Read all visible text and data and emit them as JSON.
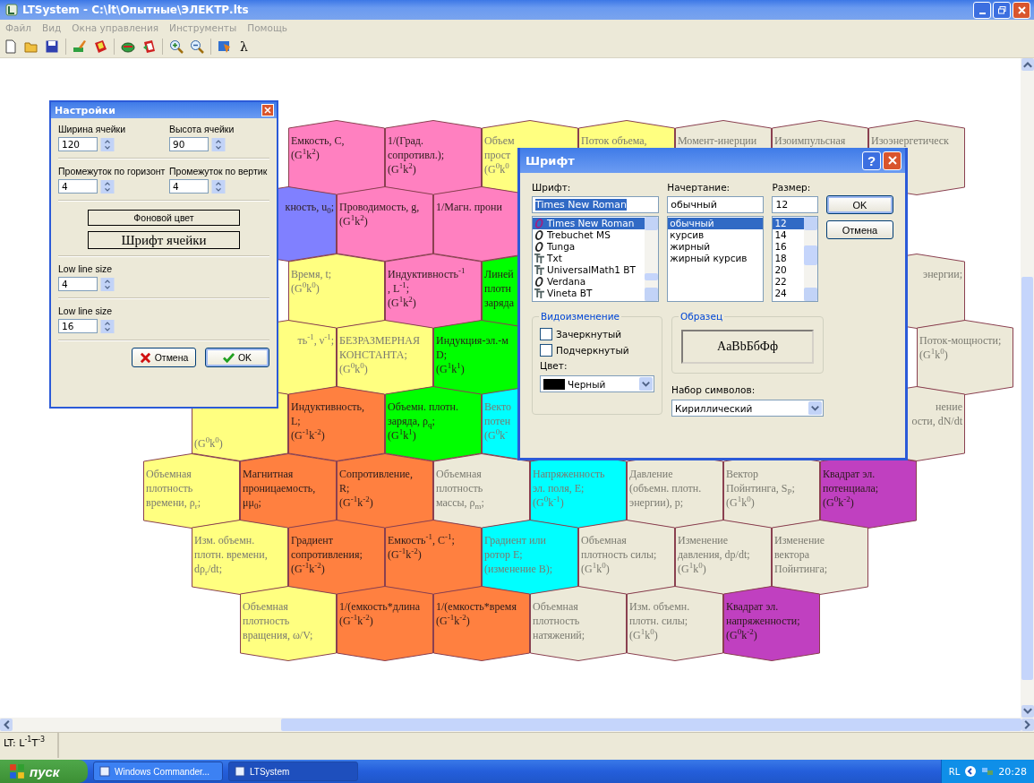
{
  "window": {
    "title": "LTSystem - C:\\lt\\Опытные\\ЭЛЕКТР.lts"
  },
  "menu": [
    "Файл",
    "Вид",
    "Окна управления",
    "Инструменты",
    "Помощь"
  ],
  "toolbar": {
    "lambda": "λ"
  },
  "grid": {
    "rows": [
      {
        "cells": [
          {
            "kind": "blank"
          },
          {
            "color": "#ff80c0",
            "kind": "full",
            "label": "Емкость, C,\n(G$^{1}$k$^{2}$)"
          },
          {
            "color": "#ff80c0",
            "kind": "full",
            "label": "1/(Град.\nсопротивл.);\n(G$^{1}$k$^{2}$)"
          },
          {
            "color": "#ffff80",
            "kind": "full",
            "label": "Объем\nпрост\n(G$^{0}$k$^{0}$"
          },
          {
            "color": "#ffff80",
            "kind": "full",
            "label": "Поток объема,"
          },
          {
            "color": "#ece9d8",
            "kind": "full",
            "label": "Момент-инерции"
          },
          {
            "color": "#ece9d8",
            "kind": "full",
            "label": "Изоимпульсная"
          },
          {
            "color": "#ece9d8",
            "kind": "full",
            "label": "Изоэнергетическ"
          }
        ]
      },
      {
        "cells": [
          {
            "kind": "blank"
          },
          {
            "color": "#8080ff",
            "kind": "cut-left",
            "label": "кность, u$_{0}$;"
          },
          {
            "color": "#ff80c0",
            "kind": "full",
            "label": "Проводимость, g,\n(G$^{1}$k$^{2}$)"
          },
          {
            "color": "#ff80c0",
            "kind": "full",
            "label": "1/Магн. прони"
          }
        ]
      },
      {
        "cells": [
          {
            "kind": "blank"
          },
          {
            "color": "#ffff80",
            "kind": "full",
            "label": "Время, t;\n(G$^{0}$k$^{0}$)"
          },
          {
            "color": "#ff80c0",
            "kind": "full",
            "label": "Индуктивность$^{-1}$\n, L$^{-1}$;\n(G$^{1}$k$^{2}$)"
          },
          {
            "color": "#00ff00",
            "kind": "full",
            "label": "Линей\nплотн\nзаряда"
          },
          {
            "kind": "blank"
          },
          {
            "kind": "blank"
          },
          {
            "kind": "blank"
          },
          {
            "color": "#ece9d8",
            "kind": "cut-left",
            "label": "энергии;"
          }
        ]
      },
      {
        "cells": [
          {
            "kind": "blank"
          },
          {
            "color": "#ffff80",
            "kind": "cut-left",
            "label": "ть$^{-1}$, ν$^{-1}$;"
          },
          {
            "color": "#ffff80",
            "kind": "full",
            "label": "БЕЗРАЗМЕРНАЯ\nКОНСТАНТА;\n(G$^{0}$k$^{0}$)"
          },
          {
            "color": "#00ff00",
            "kind": "full",
            "label": "Индукция-эл.-м\nD;\n(G$^{1}$k$^{1}$)"
          },
          {
            "kind": "blank"
          },
          {
            "kind": "blank"
          },
          {
            "kind": "blank"
          },
          {
            "kind": "blank"
          },
          {
            "color": "#ece9d8",
            "kind": "full",
            "label": "Поток-мощности;\n(G$^{1}$k$^{0}$)"
          }
        ]
      },
      {
        "cells": [
          {
            "color": "#ffff80",
            "kind": "cut-top",
            "label": "(G$^{0}$k$^{0}$)"
          },
          {
            "color": "#ff8040",
            "kind": "full",
            "label": "Индуктивность,\nL;\n(G$^{-1}$k$^{-2}$)"
          },
          {
            "color": "#00ff00",
            "kind": "full",
            "label": "Объемн. плотн.\nзаряда, ρ$_{q}$;\n(G$^{1}$k$^{1}$)"
          },
          {
            "color": "#00ffff",
            "kind": "full",
            "label": "Векто\nпотен\n(G$^{0}$k$^{-}$"
          },
          {
            "kind": "blank"
          },
          {
            "kind": "blank"
          },
          {
            "kind": "blank"
          },
          {
            "color": "#ece9d8",
            "kind": "cut-left",
            "label": "нение\nости, dN/dt"
          }
        ]
      },
      {
        "cells": [
          {
            "color": "#ffff80",
            "kind": "full",
            "label": "Объемная\nплотность\nвремени, ρ$_{r}$;"
          },
          {
            "color": "#ff8040",
            "kind": "full",
            "label": "Магнитная\nпроницаемость,\nμμ$_{0}$;"
          },
          {
            "color": "#ff8040",
            "kind": "full",
            "label": "Сопротивление,\nR;\n(G$^{-1}$k$^{-2}$)"
          },
          {
            "color": "#ece9d8",
            "kind": "full",
            "label": "Объемная\nплотность\nмассы, ρ$_{m}$;"
          },
          {
            "color": "#00ffff",
            "kind": "full",
            "label": "Напряженность\nэл. поля, E;\n(G$^{0}$k$^{-1}$)"
          },
          {
            "color": "#ece9d8",
            "kind": "full",
            "label": "Давление\n(объемн. плотн.\nэнергии), p;"
          },
          {
            "color": "#ece9d8",
            "kind": "full",
            "label": "Вектор\nПойнтинга, S$_{P}$;\n(G$^{1}$k$^{0}$)"
          },
          {
            "color": "#c040c0",
            "kind": "full",
            "label": "Квадрат эл.\nпотенциала;\n(G$^{0}$k$^{-2}$)"
          }
        ]
      },
      {
        "cells": [
          {
            "color": "#ffff80",
            "kind": "full",
            "label": "Изм. объемн.\nплотн. времени,\ndρ$_{r}$/dt;"
          },
          {
            "color": "#ff8040",
            "kind": "full",
            "label": "Градиент\nсопротивления;\n(G$^{-1}$k$^{-2}$)"
          },
          {
            "color": "#ff8040",
            "kind": "full",
            "label": "Емкость$^{-1}$, C$^{-1}$;\n(G$^{-1}$k$^{-2}$)"
          },
          {
            "color": "#00ffff",
            "kind": "full",
            "label": "Градиент или\nротор E;\n(изменение B);"
          },
          {
            "color": "#ece9d8",
            "kind": "full",
            "label": "Объемная\nплотность силы;\n(G$^{1}$k$^{0}$)"
          },
          {
            "color": "#ece9d8",
            "kind": "full",
            "label": "Изменение\nдавления, dp/dt;\n(G$^{1}$k$^{0}$)"
          },
          {
            "color": "#ece9d8",
            "kind": "full",
            "label": "Изменение\nвектора\nПойнтинга;"
          }
        ]
      },
      {
        "cells": [
          {
            "kind": "blank"
          },
          {
            "color": "#ffff80",
            "kind": "full",
            "label": "Объемная\nплотность\nвращения, ω/V;"
          },
          {
            "color": "#ff8040",
            "kind": "full",
            "label": "1/(емкость*длина\n(G$^{-1}$k$^{-2}$)"
          },
          {
            "color": "#ff8040",
            "kind": "full",
            "label": "1/(емкость*время\n(G$^{-1}$k$^{-2}$)"
          },
          {
            "color": "#ece9d8",
            "kind": "full",
            "label": "Объемная\nплотность\nнатяжений;"
          },
          {
            "color": "#ece9d8",
            "kind": "full",
            "label": "Изм. объемн.\nплотн. силы;\n(G$^{1}$k$^{0}$)"
          },
          {
            "color": "#c040c0",
            "kind": "full",
            "label": "Квадрат эл.\nнапряженности;\n(G$^{0}$k$^{-2}$)"
          }
        ]
      }
    ]
  },
  "settings": {
    "title": "Настройки",
    "fields": [
      {
        "label": "Ширина ячейки",
        "value": "120"
      },
      {
        "label": "Высота ячейки",
        "value": "90"
      },
      {
        "label": "Промежуток по горизонт",
        "value": "4"
      },
      {
        "label": "Промежуток по вертик",
        "value": "4"
      }
    ],
    "color_button": "Фоновой цвет",
    "font_button": "Шрифт ячейки",
    "line_fields": [
      {
        "label": "Low line size",
        "value": "4"
      },
      {
        "label": "Low line size",
        "value": "16"
      }
    ],
    "cancel": "Отмена",
    "ok": "OK"
  },
  "font_dialog": {
    "title": "Шрифт",
    "help": "?",
    "font": {
      "label": "Шрифт:",
      "value": "Times New Roman",
      "items": [
        {
          "label": "Times New Roman",
          "kind": "opentype",
          "selected": true
        },
        {
          "label": "Trebuchet MS",
          "kind": "opentype",
          "selected": false
        },
        {
          "label": "Tunga",
          "kind": "opentype",
          "selected": false
        },
        {
          "label": "Txt",
          "kind": "truetype",
          "selected": false
        },
        {
          "label": "UniversalMath1 BT",
          "kind": "truetype",
          "selected": false
        },
        {
          "label": "Verdana",
          "kind": "opentype",
          "selected": false
        },
        {
          "label": "Vineta BT",
          "kind": "truetype",
          "selected": false
        }
      ]
    },
    "style": {
      "label": "Начертание:",
      "value": "обычный",
      "items": [
        {
          "label": "обычный",
          "selected": true
        },
        {
          "label": "курсив",
          "selected": false
        },
        {
          "label": "жирный",
          "selected": false
        },
        {
          "label": "жирный курсив",
          "selected": false
        }
      ]
    },
    "size": {
      "label": "Размер:",
      "value": "12",
      "items": [
        {
          "label": "12",
          "selected": true
        },
        {
          "label": "14",
          "selected": false
        },
        {
          "label": "16",
          "selected": false
        },
        {
          "label": "18",
          "selected": false
        },
        {
          "label": "20",
          "selected": false
        },
        {
          "label": "22",
          "selected": false
        },
        {
          "label": "24",
          "selected": false
        }
      ]
    },
    "ok": "OK",
    "cancel": "Отмена",
    "effects": {
      "title": "Видоизменение",
      "checkboxes": [
        {
          "label": "Зачеркнутый",
          "checked": false
        },
        {
          "label": "Подчеркнутый",
          "checked": false
        }
      ],
      "color_label": "Цвет:",
      "color_value": "Черный",
      "color": "#000000"
    },
    "sample": {
      "title": "Образец",
      "text": "AaBbБбФф"
    },
    "charset": {
      "label": "Набор символов:",
      "value": "Кириллический"
    }
  },
  "status_bar": {
    "text": "LT: L$^{-1}$T$^{-3}$"
  },
  "taskbar": {
    "start": "пуск",
    "tasks": [
      {
        "label": "Windows Commander...",
        "selected": false
      },
      {
        "label": "LTSystem",
        "selected": true
      }
    ],
    "lang": "RL",
    "clock": "20:28"
  }
}
